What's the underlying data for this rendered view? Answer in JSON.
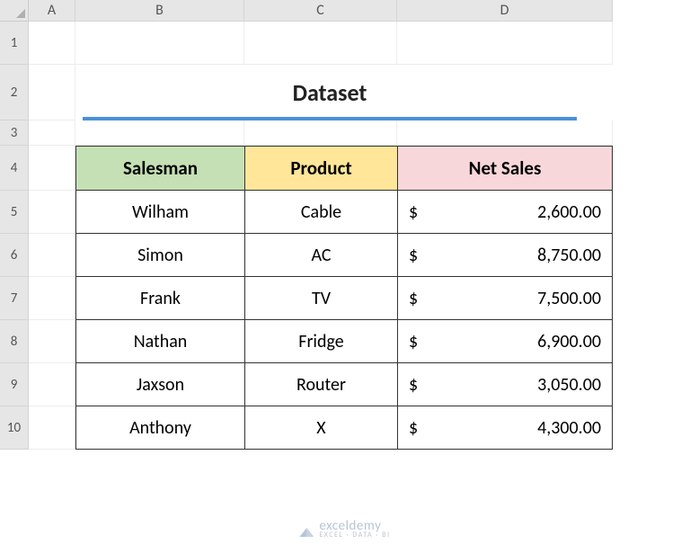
{
  "columns": [
    "A",
    "B",
    "C",
    "D"
  ],
  "row_numbers": [
    "1",
    "2",
    "3",
    "4",
    "5",
    "6",
    "7",
    "8",
    "9",
    "10"
  ],
  "title": "Dataset",
  "table": {
    "headers": {
      "salesman": "Salesman",
      "product": "Product",
      "net_sales": "Net Sales"
    },
    "currency_symbol": "$",
    "rows": [
      {
        "salesman": "Wilham",
        "product": "Cable",
        "net_sales": "2,600.00"
      },
      {
        "salesman": "Simon",
        "product": "AC",
        "net_sales": "8,750.00"
      },
      {
        "salesman": "Frank",
        "product": "TV",
        "net_sales": "7,500.00"
      },
      {
        "salesman": "Nathan",
        "product": "Fridge",
        "net_sales": "6,900.00"
      },
      {
        "salesman": "Jaxson",
        "product": "Router",
        "net_sales": "3,050.00"
      },
      {
        "salesman": "Anthony",
        "product": "X",
        "net_sales": "4,300.00"
      }
    ]
  },
  "watermark": {
    "brand": "exceldemy",
    "tagline": "EXCEL · DATA · BI"
  }
}
